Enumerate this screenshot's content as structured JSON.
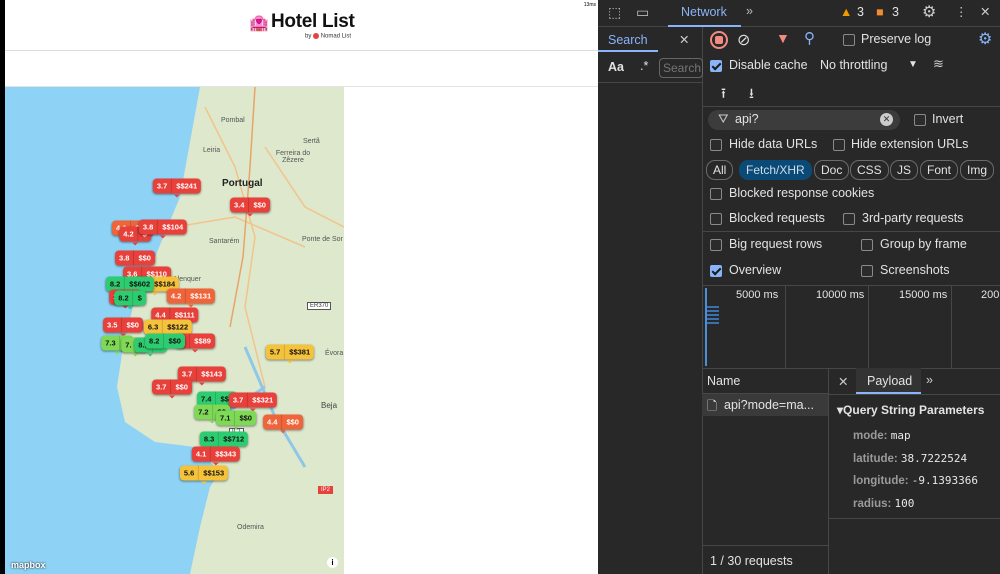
{
  "page": {
    "title": "Hotel List",
    "byline_by": "by",
    "byline_brand": "Nomad List",
    "timer": "13ms"
  },
  "map": {
    "labels": [
      "Pombal",
      "Leiria",
      "Sertã",
      "Ferreira do Zêzere",
      "Portugal",
      "Santarém",
      "Ponte de Sor",
      "Alenquer",
      "Évora",
      "Odemira",
      "Beja"
    ],
    "road_labels": [
      "ER370",
      "IC1",
      "IP2"
    ],
    "attribution": "mapbox",
    "info_icon": "i",
    "colors": {
      "red": "#e8403a",
      "orange": "#f0643a",
      "yellow": "#f5c23c",
      "green": "#2ecc71",
      "lightgreen": "#7ed957"
    },
    "markers": [
      {
        "rating": "4.2",
        "price": "$$...",
        "color": "orange"
      },
      {
        "rating": "4.2",
        "price": "$",
        "color": "red"
      },
      {
        "rating": "3.8",
        "price": "$$104",
        "color": "red"
      },
      {
        "rating": "3.7",
        "price": "$$241",
        "color": "red"
      },
      {
        "rating": "3.4",
        "price": "$$0",
        "color": "red"
      },
      {
        "rating": "3.8",
        "price": "$$0",
        "color": "red"
      },
      {
        "rating": "3.6",
        "price": "$$110",
        "color": "red"
      },
      {
        "rating": "3.9",
        "price": "$$184",
        "color": "yellow"
      },
      {
        "rating": "8.2",
        "price": "$$602",
        "color": "green"
      },
      {
        "rating": "3.",
        "price": "$1",
        "color": "red"
      },
      {
        "rating": "8.2",
        "price": "$",
        "color": "green"
      },
      {
        "rating": "4.2",
        "price": "$$131",
        "color": "orange"
      },
      {
        "rating": "4.4",
        "price": "$$111",
        "color": "red"
      },
      {
        "rating": "3.5",
        "price": "$$0",
        "color": "red"
      },
      {
        "rating": "6.3",
        "price": "$$122",
        "color": "yellow"
      },
      {
        "rating": "3.",
        "price": "$$89",
        "color": "red"
      },
      {
        "rating": "7.3",
        "price": "$",
        "color": "lightgreen"
      },
      {
        "rating": "7.",
        "price": "$",
        "color": "lightgreen"
      },
      {
        "rating": "8.1",
        "price": "$",
        "color": "green"
      },
      {
        "rating": "8.2",
        "price": "$$0",
        "color": "green"
      },
      {
        "rating": "5.7",
        "price": "$$381",
        "color": "yellow"
      },
      {
        "rating": "3.7",
        "price": "$$143",
        "color": "red"
      },
      {
        "rating": "3.7",
        "price": "$$0",
        "color": "red"
      },
      {
        "rating": "7.4",
        "price": "$$0",
        "color": "green"
      },
      {
        "rating": "3.7",
        "price": "$$321",
        "color": "red"
      },
      {
        "rating": "7.2",
        "price": "$$",
        "color": "lightgreen"
      },
      {
        "rating": "7.1",
        "price": "$$0",
        "color": "lightgreen"
      },
      {
        "rating": "4.4",
        "price": "$$0",
        "color": "orange"
      },
      {
        "rating": "8.3",
        "price": "$$712",
        "color": "green"
      },
      {
        "rating": "4.1",
        "price": "$$343",
        "color": "red"
      },
      {
        "rating": "5.6",
        "price": "$$153",
        "color": "yellow"
      }
    ]
  },
  "devtools": {
    "tab": "Network",
    "more": "»",
    "warnings": "3",
    "errors": "3",
    "search": {
      "label": "Search",
      "case": "Aa",
      "regex": ".*",
      "placeholder": "Search"
    },
    "preserve_log": "Preserve log",
    "disable_cache": "Disable cache",
    "throttling": "No throttling",
    "filter_value": "api?",
    "invert": "Invert",
    "hide_data_urls": "Hide data URLs",
    "hide_extension_urls": "Hide extension URLs",
    "chips": [
      "All",
      "Fetch/XHR",
      "Doc",
      "CSS",
      "JS",
      "Font",
      "Img"
    ],
    "blocked_cookies": "Blocked response cookies",
    "blocked_requests": "Blocked requests",
    "third_party": "3rd-party requests",
    "big_rows": "Big request rows",
    "group_by_frame": "Group by frame",
    "overview": "Overview",
    "screenshots": "Screenshots",
    "timeline": [
      "5000 ms",
      "10000 ms",
      "15000 ms",
      "200"
    ],
    "name_header": "Name",
    "request_name": "api?mode=ma...",
    "payload_tab": "Payload",
    "section": "Query String Parameters",
    "params": [
      {
        "k": "mode:",
        "v": "map"
      },
      {
        "k": "latitude:",
        "v": "38.7222524"
      },
      {
        "k": "longitude:",
        "v": "-9.1393366"
      },
      {
        "k": "radius:",
        "v": "100"
      }
    ],
    "footer": "1 / 30 requests"
  }
}
